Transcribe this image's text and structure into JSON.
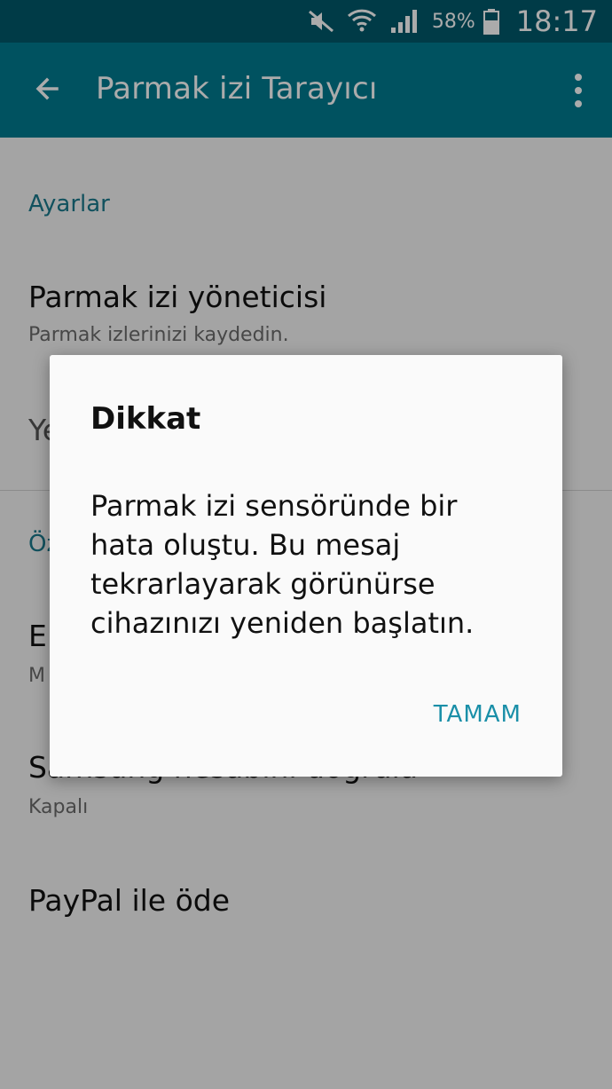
{
  "status_bar": {
    "battery_percent": "58%",
    "time": "18:17",
    "icons": [
      "mute-icon",
      "wifi-icon",
      "signal-icon",
      "battery-icon"
    ]
  },
  "app_bar": {
    "title": "Parmak izi Tarayıcı",
    "back_icon": "back-arrow-icon",
    "menu_icon": "overflow-menu-icon"
  },
  "settings": {
    "section_settings": "Ayarlar",
    "fingerprint_manager_title": "Parmak izi yöneticisi",
    "fingerprint_manager_sub": "Parmak izlerinizi kaydedin.",
    "row2_partial": "Ye",
    "section_features_partial": "Öz",
    "row3_partial_title": "El",
    "row3_partial_sub": "M",
    "samsung_title_partial": "Samsung hesabını doğrula",
    "samsung_sub": "Kapalı",
    "paypal_title": "PayPal ile öde"
  },
  "dialog": {
    "title": "Dikkat",
    "message": "Parmak izi sensöründe bir hata oluştu. Bu mesaj tekrarlayarak görünürse cihazınızı yeniden başlatın.",
    "ok_label": "TAMAM"
  },
  "colors": {
    "status_bar": "#00596b",
    "app_bar": "#007b90",
    "accent": "#1a8fa8"
  }
}
